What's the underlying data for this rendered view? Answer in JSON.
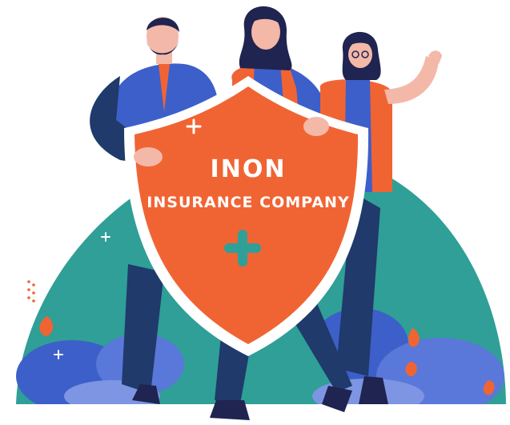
{
  "brand": {
    "name": "INON",
    "subtitle": "INSURANCE COMPANY"
  },
  "colors": {
    "teal": "#2f9f97",
    "orange": "#f06434",
    "navy": "#1f3a6b",
    "royal_blue": "#3d5fc9",
    "skin": "#f4b8a8",
    "hair": "#1f2450",
    "white": "#ffffff"
  },
  "icons": [
    "plus-icon",
    "sparkle-icon",
    "leaf-icon"
  ]
}
